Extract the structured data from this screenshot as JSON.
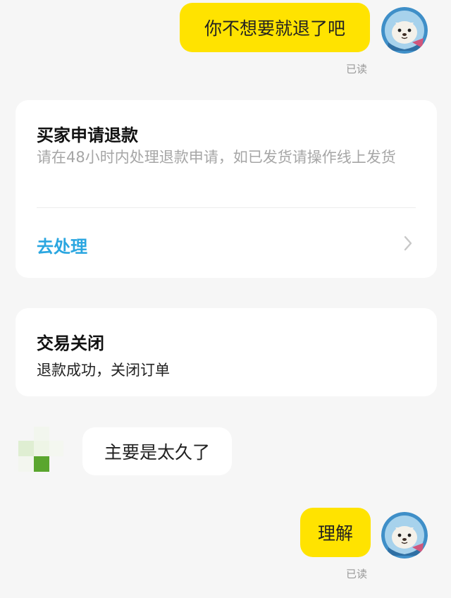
{
  "messages": [
    {
      "id": "m1",
      "direction": "out",
      "text": "你不想要就退了吧",
      "status": "已读"
    },
    {
      "id": "m2",
      "direction": "in",
      "text": "主要是太久了"
    },
    {
      "id": "m3",
      "direction": "out",
      "text": "理解",
      "status": "已读"
    }
  ],
  "refund_card": {
    "title": "买家申请退款",
    "description": "请在48小时内处理退款申请，如已发货请操作线上发货",
    "action_label": "去处理"
  },
  "closed_card": {
    "title": "交易关闭",
    "description": "退款成功，关闭订单"
  },
  "icons": {
    "self_avatar": "cartoon-seal-avatar-icon",
    "other_avatar": "pixelated-avatar-icon",
    "action_chevron": "chevron-right-icon"
  },
  "colors": {
    "outgoing_bubble": "#ffe300",
    "incoming_bubble": "#ffffff",
    "background": "#f6f6f6",
    "link": "#2aa6e0",
    "muted_text": "#a6a6a6"
  }
}
